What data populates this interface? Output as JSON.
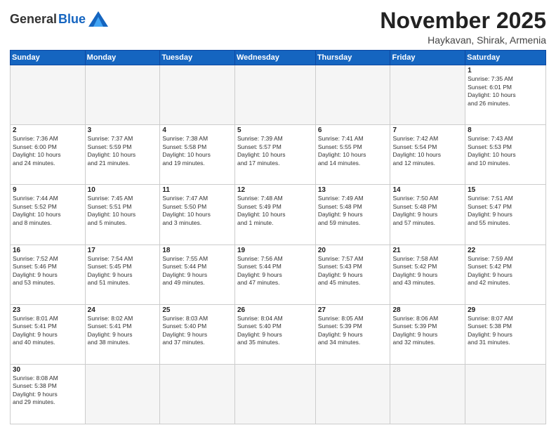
{
  "header": {
    "logo_general": "General",
    "logo_blue": "Blue",
    "month_title": "November 2025",
    "subtitle": "Haykavan, Shirak, Armenia"
  },
  "days_of_week": [
    "Sunday",
    "Monday",
    "Tuesday",
    "Wednesday",
    "Thursday",
    "Friday",
    "Saturday"
  ],
  "weeks": [
    [
      {
        "day": "",
        "info": "",
        "empty": true
      },
      {
        "day": "",
        "info": "",
        "empty": true
      },
      {
        "day": "",
        "info": "",
        "empty": true
      },
      {
        "day": "",
        "info": "",
        "empty": true
      },
      {
        "day": "",
        "info": "",
        "empty": true
      },
      {
        "day": "",
        "info": "",
        "empty": true
      },
      {
        "day": "1",
        "info": "Sunrise: 7:35 AM\nSunset: 6:01 PM\nDaylight: 10 hours\nand 26 minutes."
      }
    ],
    [
      {
        "day": "2",
        "info": "Sunrise: 7:36 AM\nSunset: 6:00 PM\nDaylight: 10 hours\nand 24 minutes."
      },
      {
        "day": "3",
        "info": "Sunrise: 7:37 AM\nSunset: 5:59 PM\nDaylight: 10 hours\nand 21 minutes."
      },
      {
        "day": "4",
        "info": "Sunrise: 7:38 AM\nSunset: 5:58 PM\nDaylight: 10 hours\nand 19 minutes."
      },
      {
        "day": "5",
        "info": "Sunrise: 7:39 AM\nSunset: 5:57 PM\nDaylight: 10 hours\nand 17 minutes."
      },
      {
        "day": "6",
        "info": "Sunrise: 7:41 AM\nSunset: 5:55 PM\nDaylight: 10 hours\nand 14 minutes."
      },
      {
        "day": "7",
        "info": "Sunrise: 7:42 AM\nSunset: 5:54 PM\nDaylight: 10 hours\nand 12 minutes."
      },
      {
        "day": "8",
        "info": "Sunrise: 7:43 AM\nSunset: 5:53 PM\nDaylight: 10 hours\nand 10 minutes."
      }
    ],
    [
      {
        "day": "9",
        "info": "Sunrise: 7:44 AM\nSunset: 5:52 PM\nDaylight: 10 hours\nand 8 minutes."
      },
      {
        "day": "10",
        "info": "Sunrise: 7:45 AM\nSunset: 5:51 PM\nDaylight: 10 hours\nand 5 minutes."
      },
      {
        "day": "11",
        "info": "Sunrise: 7:47 AM\nSunset: 5:50 PM\nDaylight: 10 hours\nand 3 minutes."
      },
      {
        "day": "12",
        "info": "Sunrise: 7:48 AM\nSunset: 5:49 PM\nDaylight: 10 hours\nand 1 minute."
      },
      {
        "day": "13",
        "info": "Sunrise: 7:49 AM\nSunset: 5:48 PM\nDaylight: 9 hours\nand 59 minutes."
      },
      {
        "day": "14",
        "info": "Sunrise: 7:50 AM\nSunset: 5:48 PM\nDaylight: 9 hours\nand 57 minutes."
      },
      {
        "day": "15",
        "info": "Sunrise: 7:51 AM\nSunset: 5:47 PM\nDaylight: 9 hours\nand 55 minutes."
      }
    ],
    [
      {
        "day": "16",
        "info": "Sunrise: 7:52 AM\nSunset: 5:46 PM\nDaylight: 9 hours\nand 53 minutes."
      },
      {
        "day": "17",
        "info": "Sunrise: 7:54 AM\nSunset: 5:45 PM\nDaylight: 9 hours\nand 51 minutes."
      },
      {
        "day": "18",
        "info": "Sunrise: 7:55 AM\nSunset: 5:44 PM\nDaylight: 9 hours\nand 49 minutes."
      },
      {
        "day": "19",
        "info": "Sunrise: 7:56 AM\nSunset: 5:44 PM\nDaylight: 9 hours\nand 47 minutes."
      },
      {
        "day": "20",
        "info": "Sunrise: 7:57 AM\nSunset: 5:43 PM\nDaylight: 9 hours\nand 45 minutes."
      },
      {
        "day": "21",
        "info": "Sunrise: 7:58 AM\nSunset: 5:42 PM\nDaylight: 9 hours\nand 43 minutes."
      },
      {
        "day": "22",
        "info": "Sunrise: 7:59 AM\nSunset: 5:42 PM\nDaylight: 9 hours\nand 42 minutes."
      }
    ],
    [
      {
        "day": "23",
        "info": "Sunrise: 8:01 AM\nSunset: 5:41 PM\nDaylight: 9 hours\nand 40 minutes."
      },
      {
        "day": "24",
        "info": "Sunrise: 8:02 AM\nSunset: 5:41 PM\nDaylight: 9 hours\nand 38 minutes."
      },
      {
        "day": "25",
        "info": "Sunrise: 8:03 AM\nSunset: 5:40 PM\nDaylight: 9 hours\nand 37 minutes."
      },
      {
        "day": "26",
        "info": "Sunrise: 8:04 AM\nSunset: 5:40 PM\nDaylight: 9 hours\nand 35 minutes."
      },
      {
        "day": "27",
        "info": "Sunrise: 8:05 AM\nSunset: 5:39 PM\nDaylight: 9 hours\nand 34 minutes."
      },
      {
        "day": "28",
        "info": "Sunrise: 8:06 AM\nSunset: 5:39 PM\nDaylight: 9 hours\nand 32 minutes."
      },
      {
        "day": "29",
        "info": "Sunrise: 8:07 AM\nSunset: 5:38 PM\nDaylight: 9 hours\nand 31 minutes."
      }
    ],
    [
      {
        "day": "30",
        "info": "Sunrise: 8:08 AM\nSunset: 5:38 PM\nDaylight: 9 hours\nand 29 minutes."
      },
      {
        "day": "",
        "info": "",
        "empty": true
      },
      {
        "day": "",
        "info": "",
        "empty": true
      },
      {
        "day": "",
        "info": "",
        "empty": true
      },
      {
        "day": "",
        "info": "",
        "empty": true
      },
      {
        "day": "",
        "info": "",
        "empty": true
      },
      {
        "day": "",
        "info": "",
        "empty": true
      }
    ]
  ]
}
